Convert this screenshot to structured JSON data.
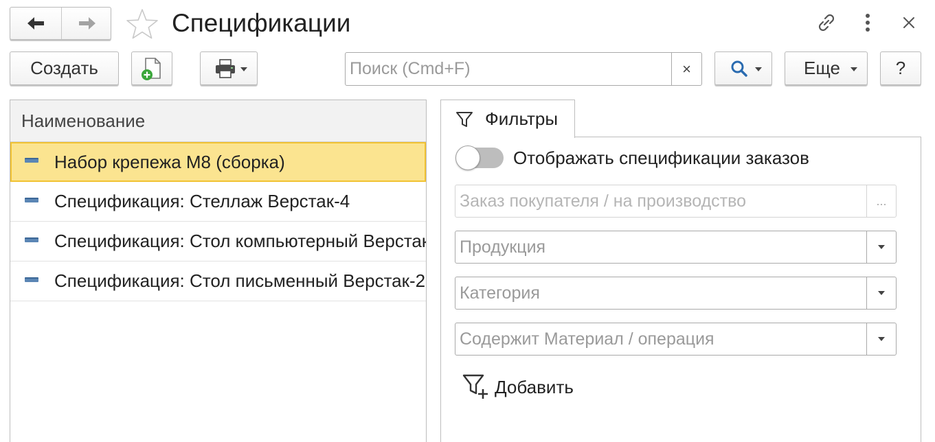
{
  "header": {
    "title": "Спецификации",
    "back_icon": "arrow-left-icon",
    "forward_icon": "arrow-right-icon",
    "favorite_icon": "star-icon",
    "link_icon": "link-icon",
    "more_icon": "kebab-menu-icon",
    "close_icon": "close-icon"
  },
  "toolbar": {
    "create_label": "Создать",
    "print_icon": "printer-icon",
    "search_placeholder": "Поиск (Cmd+F)",
    "search_clear": "×",
    "more_label": "Еще",
    "help_label": "?"
  },
  "list": {
    "column_header": "Наименование",
    "rows": [
      {
        "name": "Набор крепежа М8 (сборка)",
        "selected": true
      },
      {
        "name": "Спецификация: Стеллаж Верстак-4",
        "selected": false
      },
      {
        "name": "Спецификация: Стол компьютерный Верстак",
        "selected": false
      },
      {
        "name": "Спецификация: Стол письменный Верстак-2",
        "selected": false
      }
    ]
  },
  "filters": {
    "tab_label": "Фильтры",
    "toggle_label": "Отображать спецификации заказов",
    "toggle_on": false,
    "order_placeholder": "Заказ покупателя / на производство",
    "order_button": "...",
    "product_placeholder": "Продукция",
    "category_placeholder": "Категория",
    "material_placeholder": "Содержит Материал / операция",
    "add_label": "Добавить"
  },
  "colors": {
    "selected_row": "#fbe490",
    "selected_border": "#f1c232",
    "search_icon": "#2a6bb0",
    "add_file_plus": "#3aa63a"
  }
}
